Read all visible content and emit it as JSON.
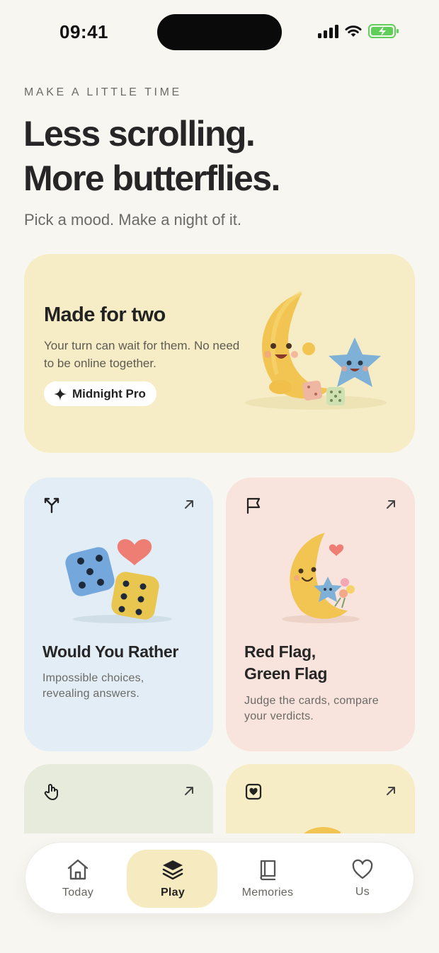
{
  "status": {
    "time": "09:41"
  },
  "header": {
    "eyebrow": "MAKE A LITTLE TIME",
    "headline_line1": "Less scrolling.",
    "headline_line2": "More butterflies.",
    "subhead": "Pick a mood. Make a night of it."
  },
  "hero": {
    "title": "Made for two",
    "description": "Your turn can wait for them. No need to be online together.",
    "pill_label": "Midnight Pro",
    "pill_icon": "sparkle-icon",
    "art": "moon-and-star-with-dice-illustration"
  },
  "cards": [
    {
      "title_line1": "Would You Rather",
      "title_line2": "",
      "description_line1": "Impossible choices,",
      "description_line2": "revealing answers.",
      "icon": "fork-icon",
      "art": "dice-and-heart-illustration"
    },
    {
      "title_line1": "Red Flag,",
      "title_line2": "Green Flag",
      "description_line1": "Judge the cards, compare",
      "description_line2": "your verdicts.",
      "icon": "flag-icon",
      "art": "moon-hugging-star-illustration"
    },
    {
      "title_line1": "",
      "icon": "tap-hand-icon"
    },
    {
      "title_line1": "",
      "icon": "heart-card-icon"
    }
  ],
  "tabs": [
    {
      "label": "Today",
      "icon": "home-icon",
      "active": false
    },
    {
      "label": "Play",
      "icon": "layers-icon",
      "active": true
    },
    {
      "label": "Memories",
      "icon": "book-icon",
      "active": false
    },
    {
      "label": "Us",
      "icon": "heart-icon",
      "active": false
    }
  ],
  "colors": {
    "background": "#f8f6f1",
    "hero_card": "#f6edc6",
    "card_blue": "#e2edf5",
    "card_pink": "#f8e4dc",
    "card_green": "#e7ebdb",
    "active_tab": "#f6ebc0",
    "battery": "#5fcf5a"
  }
}
